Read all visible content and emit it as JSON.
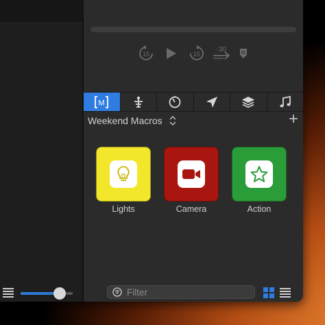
{
  "transport": {
    "skip_back_label": "15",
    "skip_forward_label": "15",
    "jump_label": "-30"
  },
  "tabs": [
    {
      "icon": "macro-bracket-icon",
      "label": "M",
      "active": true
    },
    {
      "icon": "broadcast-tower-icon",
      "active": false
    },
    {
      "icon": "timer-icon",
      "active": false
    },
    {
      "icon": "location-arrow-icon",
      "active": false
    },
    {
      "icon": "layers-icon",
      "active": false
    },
    {
      "icon": "music-note-icon",
      "active": false
    }
  ],
  "macros": {
    "collection_title": "Weekend Macros",
    "add_label": "+",
    "items": [
      {
        "label": "Lights",
        "icon": "lightbulb-icon",
        "color": "#f2e72a"
      },
      {
        "label": "Camera",
        "icon": "video-camera-icon",
        "color": "#a8160f"
      },
      {
        "label": "Action",
        "icon": "star-icon",
        "color": "#2a9d39"
      }
    ]
  },
  "filter": {
    "placeholder": "Filter",
    "value": ""
  },
  "left_slider": {
    "value_fraction": 0.75
  },
  "colors": {
    "accent": "#2f7de1",
    "panel": "#2b2b2b"
  }
}
